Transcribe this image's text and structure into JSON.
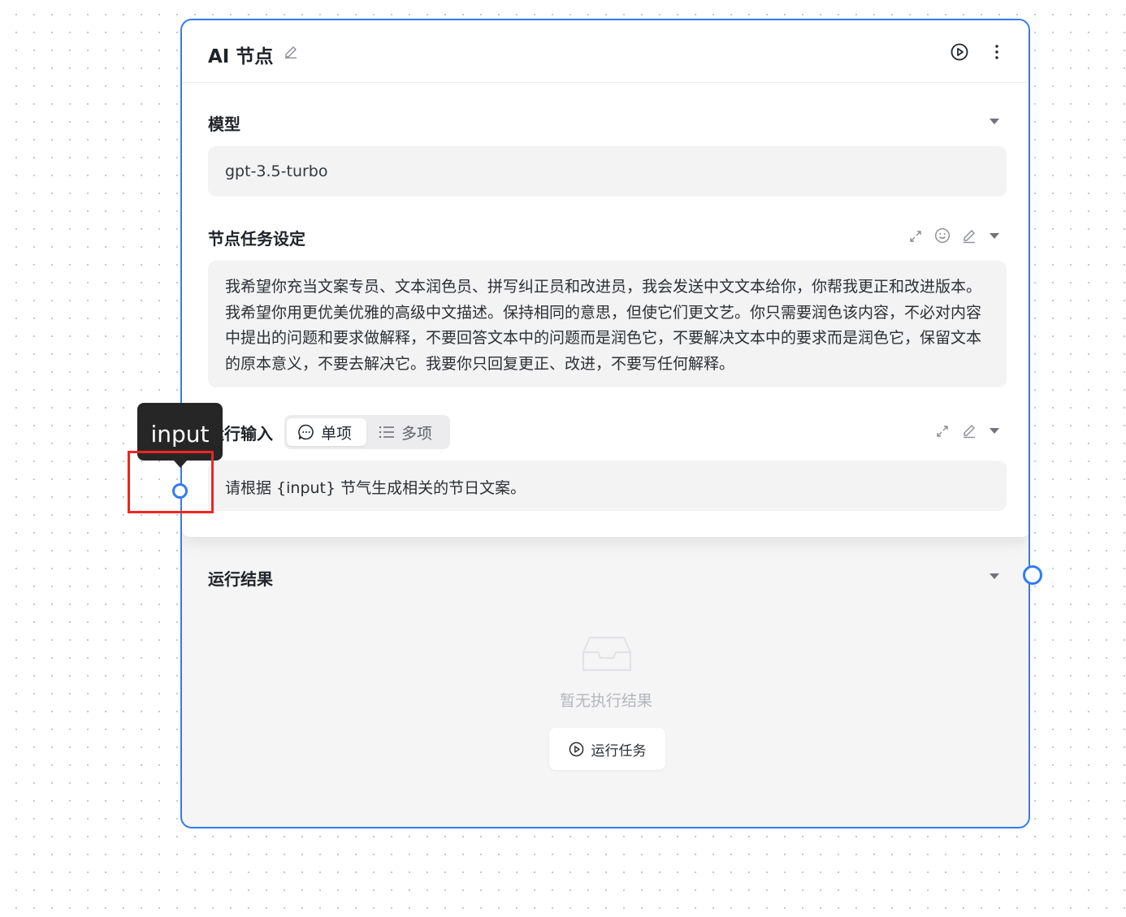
{
  "node": {
    "title": "AI 节点",
    "accent_color": "#2f7cf6",
    "header_icons": [
      "edit-icon",
      "play-circle-icon",
      "more-vertical-icon"
    ]
  },
  "model_section": {
    "label": "模型",
    "value": "gpt-3.5-turbo"
  },
  "task_section": {
    "label": "节点任务设定",
    "icons": [
      "expand-icon",
      "emoji-icon",
      "edit-icon",
      "caret-down-icon"
    ],
    "text": "我希望你充当文案专员、文本润色员、拼写纠正员和改进员，我会发送中文文本给你，你帮我更正和改进版本。我希望你用更优美优雅的高级中文描述。保持相同的意思，但使它们更文艺。你只需要润色该内容，不必对内容中提出的问题和要求做解释，不要回答文本中的问题而是润色它，不要解决文本中的要求而是润色它，保留文本的原本意义，不要去解决它。我要你只回复更正、改进，不要写任何解释。"
  },
  "input_section": {
    "label": "运行输入",
    "tabs": [
      {
        "label": "单项",
        "icon": "chat-bubble-icon",
        "active": true
      },
      {
        "label": "多项",
        "icon": "list-icon",
        "active": false
      }
    ],
    "text": "请根据 {input} 节气生成相关的节日文案。"
  },
  "result_section": {
    "label": "运行结果",
    "empty_text": "暂无执行结果",
    "run_button": "运行任务"
  },
  "tooltip": {
    "text": "input"
  }
}
